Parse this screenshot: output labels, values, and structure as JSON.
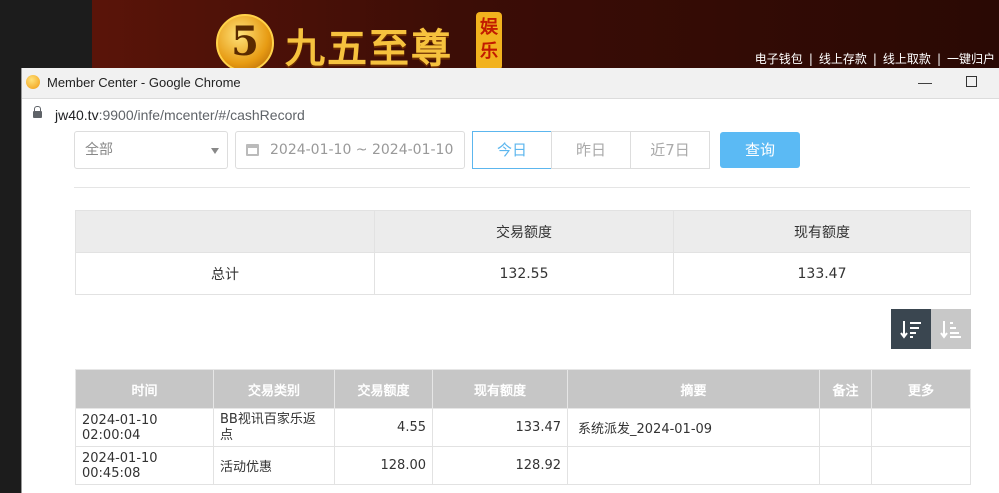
{
  "site": {
    "logo_glyph": "5",
    "logo_text": "九五至尊",
    "logo_badge": "娱乐",
    "top_links": [
      "电子钱包",
      "线上存款",
      "线上取款",
      "一键归户"
    ]
  },
  "window": {
    "title": "Member Center - Google Chrome",
    "url_host": "jw40.tv",
    "url_rest": ":9900/infe/mcenter/#/cashRecord"
  },
  "filters": {
    "type_select": "全部",
    "date_range": "2024-01-10 ~ 2024-01-10",
    "quick": [
      "今日",
      "昨日",
      "近7日"
    ],
    "active_quick": "今日",
    "query_label": "查询"
  },
  "summary": {
    "headers": [
      "",
      "交易额度",
      "现有额度"
    ],
    "row": {
      "label": "总计",
      "amount": "132.55",
      "balance": "133.47"
    }
  },
  "sort": {
    "desc_icon": "sort-desc-icon",
    "asc_icon": "sort-asc-icon"
  },
  "records": {
    "headers": [
      "时间",
      "交易类别",
      "交易额度",
      "现有额度",
      "摘要",
      "备注",
      "更多"
    ],
    "rows": [
      {
        "time": "2024-01-10 02:00:04",
        "type": "BB视讯百家乐返点",
        "amount": "4.55",
        "balance": "133.47",
        "summary": "系统派发_2024-01-09",
        "note": "",
        "more": ""
      },
      {
        "time": "2024-01-10 00:45:08",
        "type": "活动优惠",
        "amount": "128.00",
        "balance": "128.92",
        "summary": "",
        "note": "",
        "more": ""
      }
    ]
  },
  "colors": {
    "accent": "#5bbaf4",
    "header_gray": "#c6c6c6",
    "sort_active": "#3a4650"
  }
}
